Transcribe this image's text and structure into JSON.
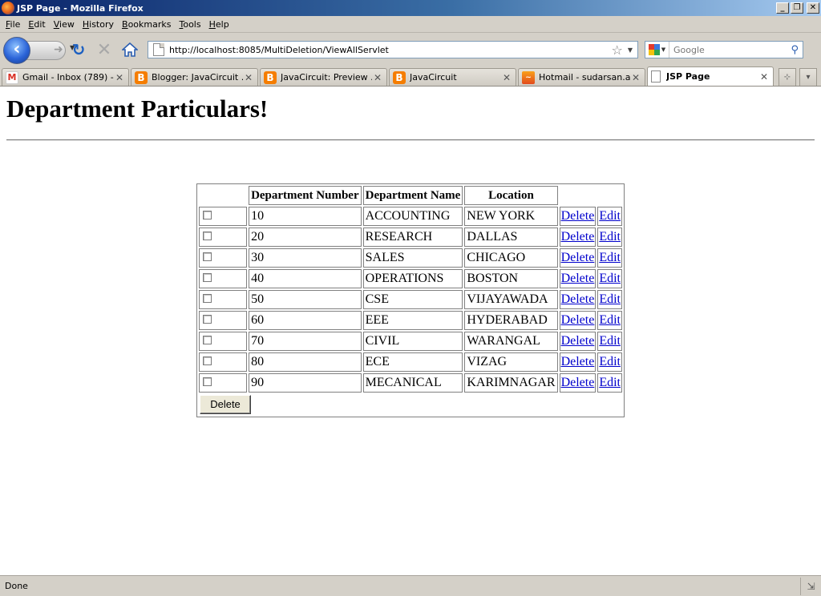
{
  "window": {
    "title": "JSP Page - Mozilla Firefox"
  },
  "menu": [
    {
      "label": "File",
      "key": "F",
      "rest": "ile"
    },
    {
      "label": "Edit",
      "key": "E",
      "rest": "dit"
    },
    {
      "label": "View",
      "key": "V",
      "rest": "iew"
    },
    {
      "label": "History",
      "key": "H",
      "rest": "istory"
    },
    {
      "label": "Bookmarks",
      "key": "B",
      "rest": "ookmarks"
    },
    {
      "label": "Tools",
      "key": "T",
      "rest": "ools"
    },
    {
      "label": "Help",
      "key": "H",
      "rest": "elp"
    }
  ],
  "nav": {
    "url": "http://localhost:8085/MultiDeletion/ViewAllServlet",
    "search_placeholder": "Google"
  },
  "tabs": [
    {
      "label": "Gmail - Inbox (789) - ...",
      "icon": "gmail-icon",
      "active": false
    },
    {
      "label": "Blogger: JavaCircuit ...",
      "icon": "blogger-icon",
      "active": false
    },
    {
      "label": "JavaCircuit: Preview ...",
      "icon": "blogger-icon",
      "active": false
    },
    {
      "label": "JavaCircuit",
      "icon": "blogger-icon",
      "active": false
    },
    {
      "label": "Hotmail - sudarsan.a...",
      "icon": "hotmail-icon",
      "active": false
    },
    {
      "label": "JSP Page",
      "icon": "page-icon",
      "active": true
    }
  ],
  "page": {
    "heading": "Department Particulars!",
    "columns": [
      "Department Number",
      "Department Name",
      "Location"
    ],
    "rows": [
      {
        "number": "10",
        "name": "ACCOUNTING",
        "location": "NEW YORK"
      },
      {
        "number": "20",
        "name": "RESEARCH",
        "location": "DALLAS"
      },
      {
        "number": "30",
        "name": "SALES",
        "location": "CHICAGO"
      },
      {
        "number": "40",
        "name": "OPERATIONS",
        "location": "BOSTON"
      },
      {
        "number": "50",
        "name": "CSE",
        "location": "VIJAYAWADA"
      },
      {
        "number": "60",
        "name": "EEE",
        "location": "HYDERABAD"
      },
      {
        "number": "70",
        "name": "CIVIL",
        "location": "WARANGAL"
      },
      {
        "number": "80",
        "name": "ECE",
        "location": "VIZAG"
      },
      {
        "number": "90",
        "name": "MECANICAL",
        "location": "KARIMNAGAR"
      }
    ],
    "delete_link": "Delete",
    "edit_link": "Edit",
    "delete_button": "Delete"
  },
  "status": {
    "text": "Done"
  },
  "colors": {
    "link": "#0000cc",
    "titlebar_start": "#0a246a",
    "titlebar_end": "#a6caf0"
  }
}
